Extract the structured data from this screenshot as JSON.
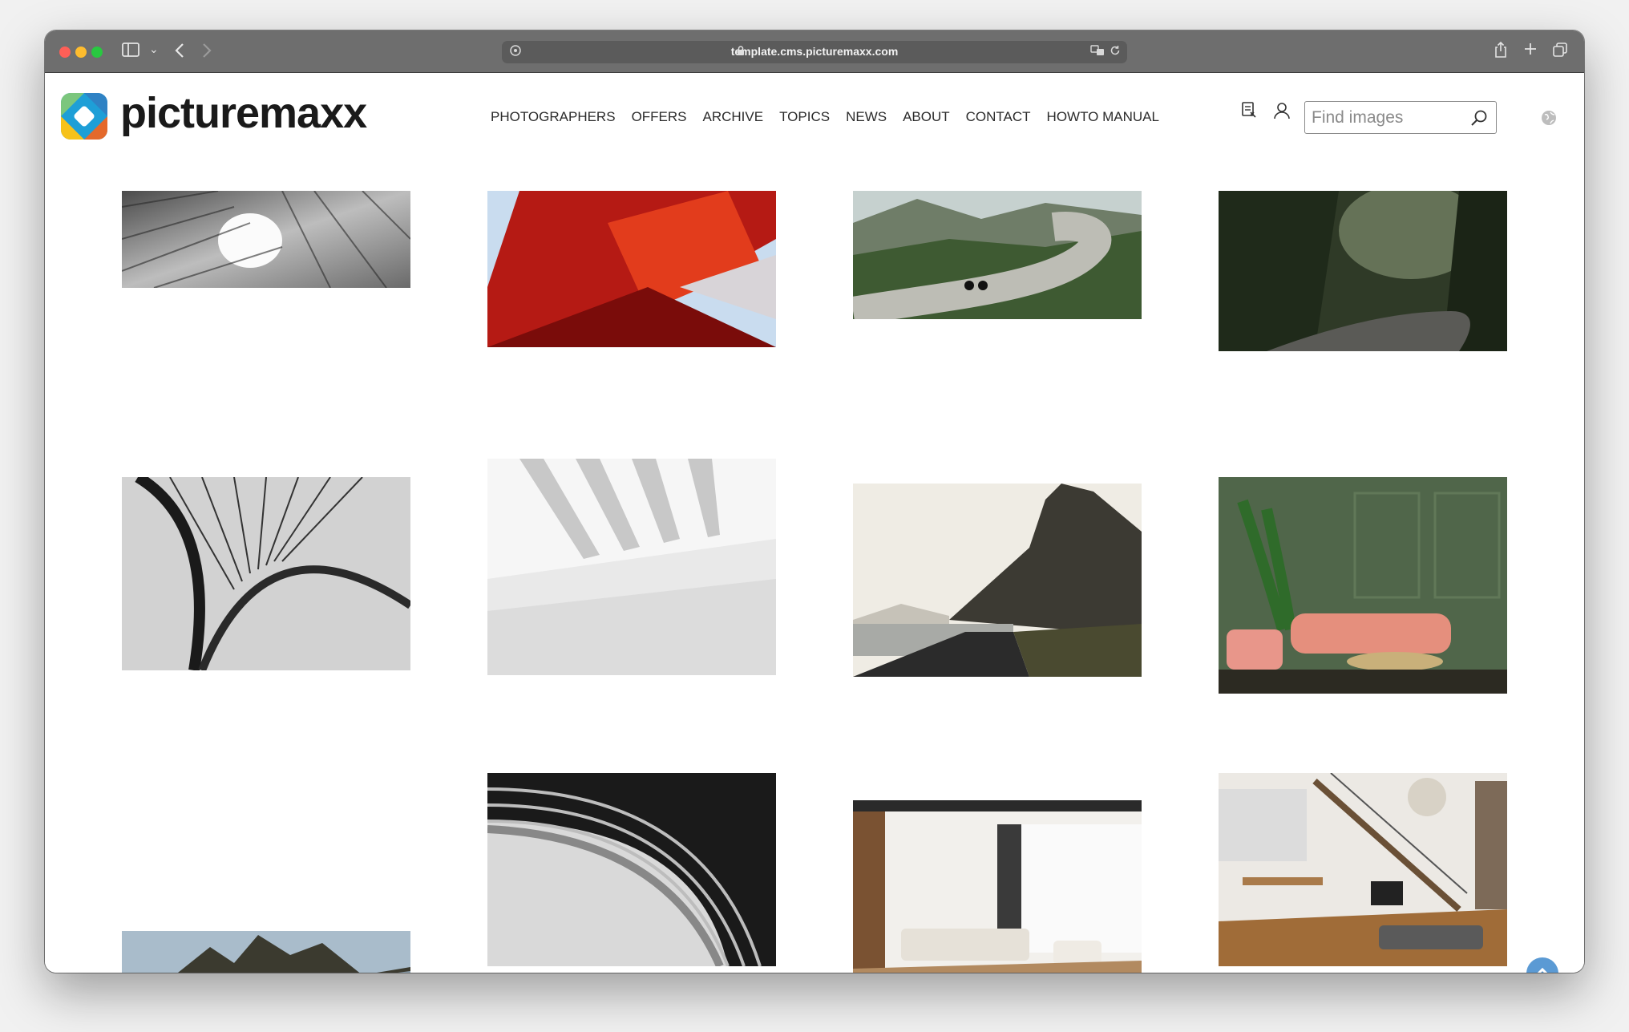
{
  "browser": {
    "url": "template.cms.picturemaxx.com",
    "icons": [
      "sidebar-icon",
      "chevron-down-icon",
      "back-icon",
      "forward-icon",
      "site-settings-icon",
      "lock-icon",
      "translate-icon",
      "reload-icon",
      "share-icon",
      "new-tab-icon",
      "tabs-overview-icon"
    ]
  },
  "header": {
    "brand": "picturemaxx",
    "nav": [
      "PHOTOGRAPHERS",
      "OFFERS",
      "ARCHIVE",
      "TOPICS",
      "NEWS",
      "ABOUT",
      "CONTACT",
      "HOWTO MANUAL"
    ],
    "search_placeholder": "Find images",
    "icons": [
      "lightbox-icon",
      "user-icon",
      "search-icon",
      "globe-icon"
    ]
  },
  "gallery": {
    "images": [
      "abstract architecture monochrome",
      "red facade architecture",
      "cyclist on mountain road",
      "cyclists on forest road",
      "bridge cables monochrome",
      "white abstract interior",
      "road along fjord and mountain",
      "green living room with pink sofa",
      "mountain landscape with lake",
      "curved architecture monochrome",
      "modern living room",
      "loft with staircase and dining"
    ]
  },
  "colors": {
    "titlebar": "#6e6e6e",
    "scroll_top": "#4a8fd0"
  }
}
